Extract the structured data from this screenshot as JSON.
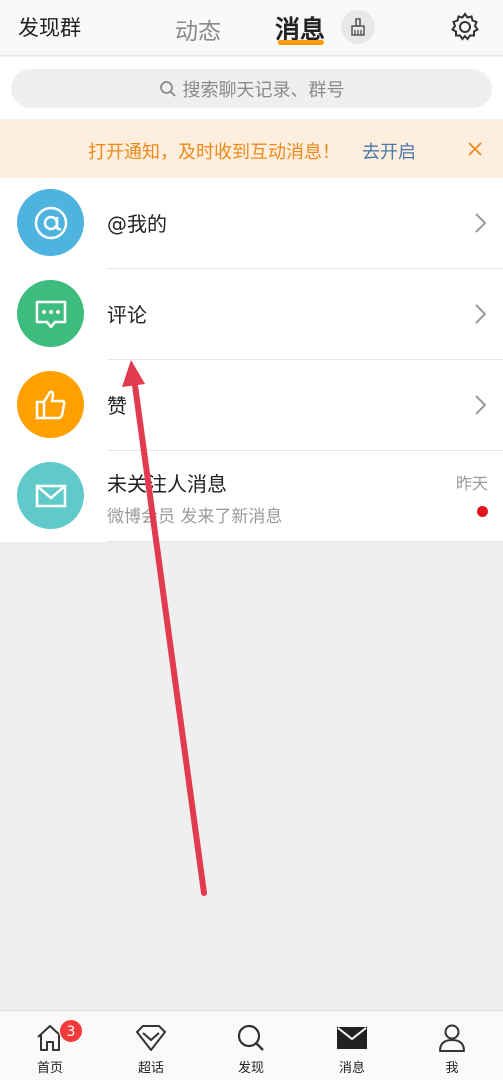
{
  "header": {
    "left_title": "发现群",
    "tabs": [
      {
        "label": "动态",
        "active": false
      },
      {
        "label": "消息",
        "active": true
      }
    ],
    "clean_icon": "broom-icon",
    "settings_icon": "gear-icon"
  },
  "search": {
    "placeholder": "搜索聊天记录、群号",
    "icon": "search-icon"
  },
  "banner": {
    "text": "打开通知，及时收到互动消息！",
    "link_label": "去开启",
    "close_icon": "close-icon"
  },
  "list": {
    "items": [
      {
        "label": "@我的",
        "icon": "at-icon",
        "color": "#4fb3e0"
      },
      {
        "label": "评论",
        "icon": "comment-icon",
        "color": "#3dbd7d"
      },
      {
        "label": "赞",
        "icon": "thumbs-up-icon",
        "color": "#ffa000"
      }
    ],
    "message": {
      "title": "未关注人消息",
      "subtitle": "微博会员 发来了新消息",
      "time": "昨天",
      "icon": "mail-icon",
      "color": "#5fcac9",
      "unread": true
    }
  },
  "bottom_nav": {
    "items": [
      {
        "label": "首页",
        "icon": "home-icon",
        "badge": "3"
      },
      {
        "label": "超话",
        "icon": "diamond-icon"
      },
      {
        "label": "发现",
        "icon": "search-icon"
      },
      {
        "label": "消息",
        "icon": "mail-icon",
        "active": true
      },
      {
        "label": "我",
        "icon": "person-icon"
      }
    ]
  },
  "colors": {
    "accent": "#ff9a00",
    "banner_bg": "#fdeede",
    "banner_text": "#ee8a1a",
    "link": "#4a78ab",
    "annotation_arrow": "#e23a4e",
    "badge": "#f23a3a"
  }
}
